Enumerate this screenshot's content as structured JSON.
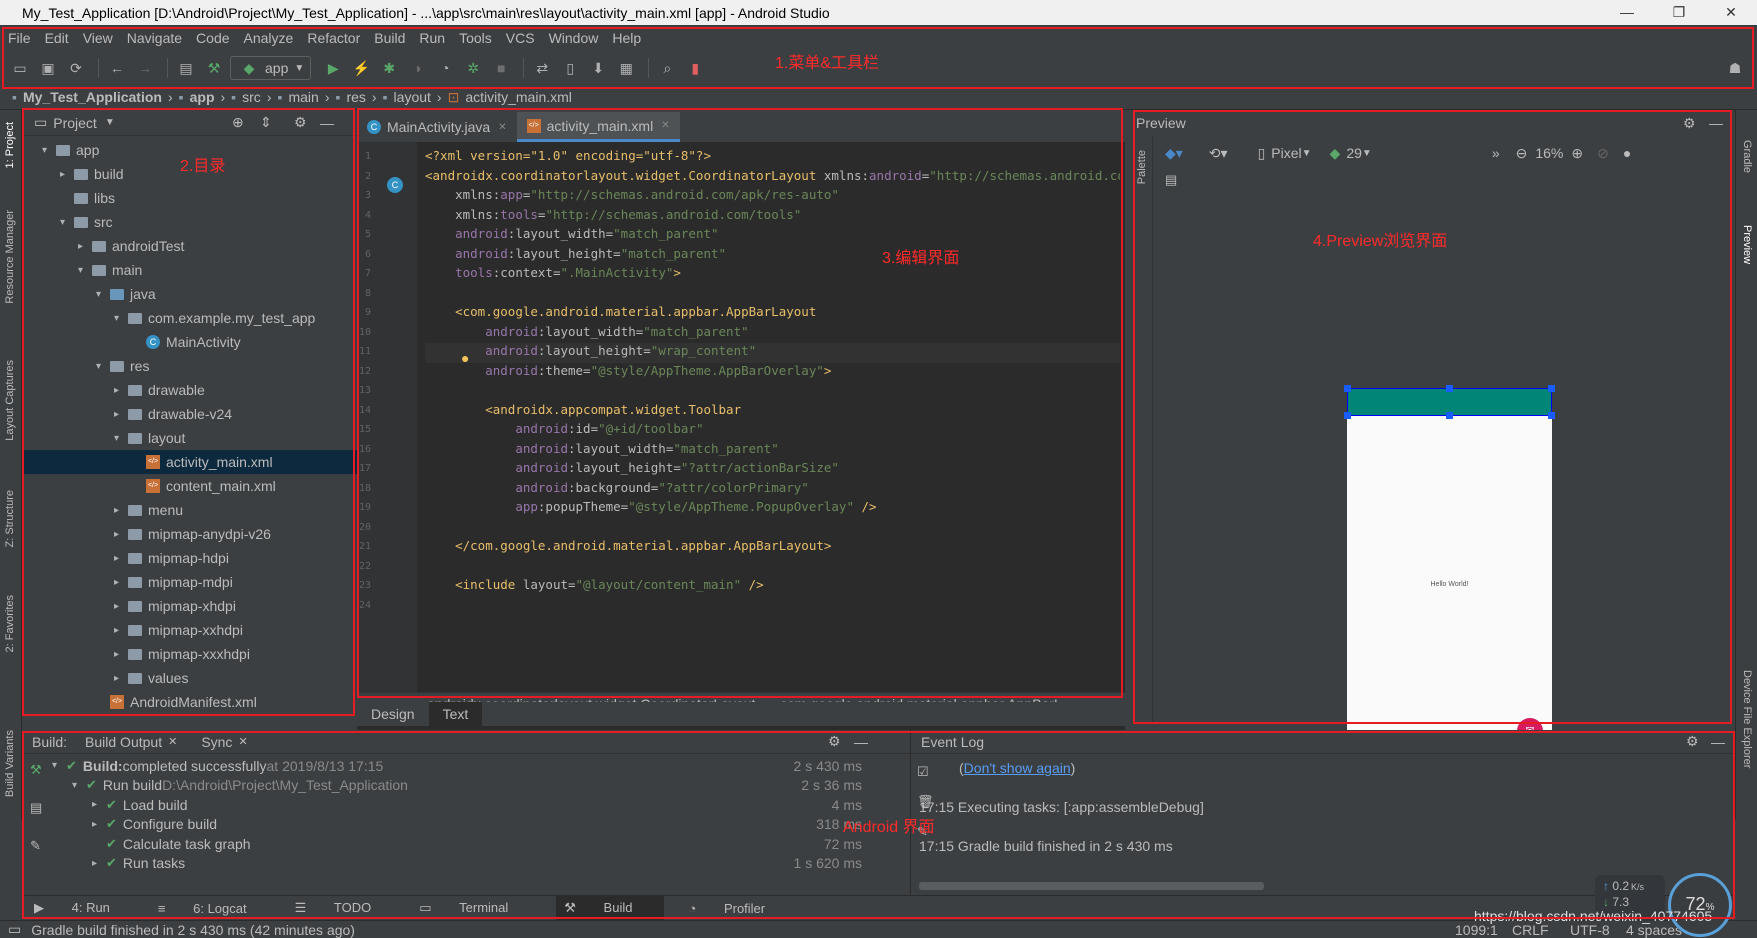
{
  "window": {
    "title": "My_Test_Application [D:\\Android\\Project\\My_Test_Application] - ...\\app\\src\\main\\res\\layout\\activity_main.xml [app] - Android Studio"
  },
  "menu": [
    "File",
    "Edit",
    "View",
    "Navigate",
    "Code",
    "Analyze",
    "Refactor",
    "Build",
    "Run",
    "Tools",
    "VCS",
    "Window",
    "Help"
  ],
  "toolbar": {
    "run_config": "app"
  },
  "breadcrumbs": [
    "My_Test_Application",
    "app",
    "src",
    "main",
    "res",
    "layout",
    "activity_main.xml"
  ],
  "left_strip": [
    "1: Project",
    "Resource Manager",
    "Layout Captures",
    "Z: Structure",
    "2: Favorites",
    "Build Variants"
  ],
  "right_strip": [
    "Gradle",
    "Preview",
    "Device File Explorer"
  ],
  "project": {
    "title": "Project",
    "tree": [
      {
        "label": "app",
        "indent": 0,
        "arrow": "▾",
        "icon": "module"
      },
      {
        "label": "build",
        "indent": 1,
        "arrow": "▸",
        "icon": "folder"
      },
      {
        "label": "libs",
        "indent": 1,
        "arrow": "",
        "icon": "folder"
      },
      {
        "label": "src",
        "indent": 1,
        "arrow": "▾",
        "icon": "folder"
      },
      {
        "label": "androidTest",
        "indent": 2,
        "arrow": "▸",
        "icon": "folder"
      },
      {
        "label": "main",
        "indent": 2,
        "arrow": "▾",
        "icon": "folder"
      },
      {
        "label": "java",
        "indent": 3,
        "arrow": "▾",
        "icon": "folder-blue"
      },
      {
        "label": "com.example.my_test_app",
        "indent": 4,
        "arrow": "▾",
        "icon": "folder"
      },
      {
        "label": "MainActivity",
        "indent": 5,
        "arrow": "",
        "icon": "class"
      },
      {
        "label": "res",
        "indent": 3,
        "arrow": "▾",
        "icon": "folder"
      },
      {
        "label": "drawable",
        "indent": 4,
        "arrow": "▸",
        "icon": "folder"
      },
      {
        "label": "drawable-v24",
        "indent": 4,
        "arrow": "▸",
        "icon": "folder"
      },
      {
        "label": "layout",
        "indent": 4,
        "arrow": "▾",
        "icon": "folder"
      },
      {
        "label": "activity_main.xml",
        "indent": 5,
        "arrow": "",
        "icon": "xml",
        "selected": true
      },
      {
        "label": "content_main.xml",
        "indent": 5,
        "arrow": "",
        "icon": "xml"
      },
      {
        "label": "menu",
        "indent": 4,
        "arrow": "▸",
        "icon": "folder"
      },
      {
        "label": "mipmap-anydpi-v26",
        "indent": 4,
        "arrow": "▸",
        "icon": "folder"
      },
      {
        "label": "mipmap-hdpi",
        "indent": 4,
        "arrow": "▸",
        "icon": "folder"
      },
      {
        "label": "mipmap-mdpi",
        "indent": 4,
        "arrow": "▸",
        "icon": "folder"
      },
      {
        "label": "mipmap-xhdpi",
        "indent": 4,
        "arrow": "▸",
        "icon": "folder"
      },
      {
        "label": "mipmap-xxhdpi",
        "indent": 4,
        "arrow": "▸",
        "icon": "folder"
      },
      {
        "label": "mipmap-xxxhdpi",
        "indent": 4,
        "arrow": "▸",
        "icon": "folder"
      },
      {
        "label": "values",
        "indent": 4,
        "arrow": "▸",
        "icon": "folder"
      },
      {
        "label": "AndroidManifest.xml",
        "indent": 3,
        "arrow": "",
        "icon": "xml"
      }
    ]
  },
  "editor": {
    "tabs": [
      {
        "label": "MainActivity.java",
        "active": false
      },
      {
        "label": "activity_main.xml",
        "active": true
      }
    ],
    "code": [
      [
        [
          "t",
          "<?xml version=\"1.0\" encoding=\"utf-8\"?>"
        ]
      ],
      [
        [
          "g",
          "<"
        ],
        [
          "t",
          "androidx.coordinatorlayout.widget.CoordinatorLayout "
        ],
        [
          "a",
          "xmlns:"
        ],
        [
          "n",
          "android"
        ],
        [
          "a",
          "="
        ],
        [
          "v",
          "\"http://schemas.android.com/apk/res/android\""
        ]
      ],
      [
        [
          "p",
          "    "
        ],
        [
          "a",
          "xmlns:"
        ],
        [
          "n",
          "app"
        ],
        [
          "a",
          "="
        ],
        [
          "v",
          "\"http://schemas.android.com/apk/res-auto\""
        ]
      ],
      [
        [
          "p",
          "    "
        ],
        [
          "a",
          "xmlns:"
        ],
        [
          "n",
          "tools"
        ],
        [
          "a",
          "="
        ],
        [
          "v",
          "\"http://schemas.android.com/tools\""
        ]
      ],
      [
        [
          "p",
          "    "
        ],
        [
          "n",
          "android"
        ],
        [
          "a",
          ":layout_width="
        ],
        [
          "v",
          "\"match_parent\""
        ]
      ],
      [
        [
          "p",
          "    "
        ],
        [
          "n",
          "android"
        ],
        [
          "a",
          ":layout_height="
        ],
        [
          "v",
          "\"match_parent\""
        ]
      ],
      [
        [
          "p",
          "    "
        ],
        [
          "n",
          "tools"
        ],
        [
          "a",
          ":context="
        ],
        [
          "v",
          "\".MainActivity\""
        ],
        [
          "g",
          ">"
        ]
      ],
      [
        [
          "p",
          ""
        ]
      ],
      [
        [
          "p",
          "    "
        ],
        [
          "t",
          "<com.google.android.material.appbar.AppBarLayout"
        ]
      ],
      [
        [
          "p",
          "        "
        ],
        [
          "n",
          "android"
        ],
        [
          "a",
          ":layout_width="
        ],
        [
          "v",
          "\"match_parent\""
        ]
      ],
      [
        [
          "p",
          "        "
        ],
        [
          "n",
          "android"
        ],
        [
          "a",
          ":layout_height="
        ],
        [
          "v",
          "\"wrap_content\""
        ]
      ],
      [
        [
          "p",
          "        "
        ],
        [
          "n",
          "android"
        ],
        [
          "a",
          ":theme="
        ],
        [
          "v",
          "\"@style/AppTheme.AppBarOverlay\""
        ],
        [
          "g",
          ">"
        ]
      ],
      [
        [
          "p",
          ""
        ]
      ],
      [
        [
          "p",
          "        "
        ],
        [
          "t",
          "<androidx.appcompat.widget.Toolbar"
        ]
      ],
      [
        [
          "p",
          "            "
        ],
        [
          "n",
          "android"
        ],
        [
          "a",
          ":id="
        ],
        [
          "v",
          "\"@+id/toolbar\""
        ]
      ],
      [
        [
          "p",
          "            "
        ],
        [
          "n",
          "android"
        ],
        [
          "a",
          ":layout_width="
        ],
        [
          "v",
          "\"match_parent\""
        ]
      ],
      [
        [
          "p",
          "            "
        ],
        [
          "n",
          "android"
        ],
        [
          "a",
          ":layout_height="
        ],
        [
          "v",
          "\"?attr/actionBarSize\""
        ]
      ],
      [
        [
          "p",
          "            "
        ],
        [
          "n",
          "android"
        ],
        [
          "a",
          ":background="
        ],
        [
          "v",
          "\"?attr/colorPrimary\""
        ]
      ],
      [
        [
          "p",
          "            "
        ],
        [
          "n",
          "app"
        ],
        [
          "a",
          ":popupTheme="
        ],
        [
          "v",
          "\"@style/AppTheme.PopupOverlay\""
        ],
        [
          "g",
          " />"
        ]
      ],
      [
        [
          "p",
          ""
        ]
      ],
      [
        [
          "p",
          "    "
        ],
        [
          "t",
          "</com.google.android.material.appbar.AppBarLayout>"
        ]
      ],
      [
        [
          "p",
          ""
        ]
      ],
      [
        [
          "p",
          "    "
        ],
        [
          "t",
          "<include "
        ],
        [
          "a",
          "layout="
        ],
        [
          "v",
          "\"@layout/content_main\""
        ],
        [
          "g",
          " />"
        ]
      ],
      [
        [
          "p",
          ""
        ]
      ]
    ],
    "crumbs": [
      "androidx.coordinatorlayout.widget.CoordinatorLayout",
      "com.google.android.material.appbar.AppBarL"
    ],
    "design_tabs": [
      "Design",
      "Text"
    ]
  },
  "preview": {
    "title": "Preview",
    "device": "Pixel",
    "api": "29",
    "zoom": "16%",
    "hello_text": "Hello World!",
    "palette_label": "Palette"
  },
  "build": {
    "tabs": [
      "Build:",
      "Build Output",
      "Sync"
    ],
    "rows": [
      {
        "label": "Build:",
        "rest": " completed successfully",
        "extra": " at 2019/8/13 17:15",
        "time": "2 s 430 ms",
        "indent": 0,
        "arrow": "▾"
      },
      {
        "label": "Run build",
        "rest": "",
        "extra": " D:\\Android\\Project\\My_Test_Application",
        "time": "2 s 36 ms",
        "indent": 1,
        "arrow": "▾"
      },
      {
        "label": "Load build",
        "rest": "",
        "extra": "",
        "time": "4 ms",
        "indent": 2,
        "arrow": "▸"
      },
      {
        "label": "Configure build",
        "rest": "",
        "extra": "",
        "time": "318 ms",
        "indent": 2,
        "arrow": "▸"
      },
      {
        "label": "Calculate task graph",
        "rest": "",
        "extra": "",
        "time": "72 ms",
        "indent": 2,
        "arrow": ""
      },
      {
        "label": "Run tasks",
        "rest": "",
        "extra": "",
        "time": "1 s 620 ms",
        "indent": 2,
        "arrow": "▸"
      }
    ]
  },
  "event_log": {
    "title": "Event Log",
    "link_prefix": "(",
    "link": "Don't show again",
    "link_suffix": ")",
    "lines": [
      "17:15 Executing tasks: [:app:assembleDebug]",
      "17:15 Gradle build finished in 2 s 430 ms"
    ]
  },
  "bottom_tools": [
    "4: Run",
    "6: Logcat",
    "TODO",
    "Terminal",
    "Build",
    "Profiler"
  ],
  "status": {
    "message": "Gradle build finished in 2 s 430 ms (42 minutes ago)",
    "position": "1099:1",
    "line_sep": "CRLF",
    "encoding": "UTF-8",
    "indent": "4 spaces"
  },
  "overlay": {
    "speed_up": "0.2",
    "speed_unit": "K/s",
    "speed_down": "7.3",
    "gauge": "72",
    "gauge_unit": "%",
    "watermark": "https://blog.csdn.net/weixin_40774605"
  },
  "annotations": [
    "1.菜单&工具栏",
    "2.目录",
    "3.编辑界面",
    "4.Preview浏览界面",
    "Android 界面"
  ],
  "colors": {
    "red": "#e51c23",
    "appbar": "#008577",
    "fab": "#d81b60"
  }
}
